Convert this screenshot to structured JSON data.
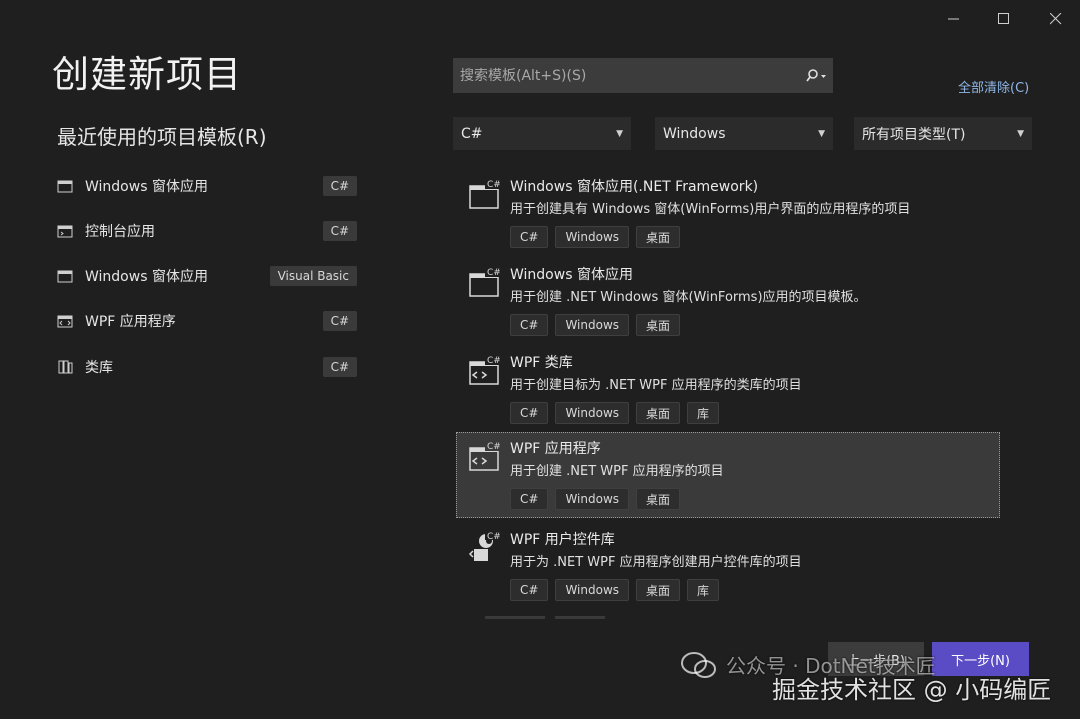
{
  "window": {
    "min_icon": "minimize-icon",
    "max_icon": "maximize-icon",
    "close_icon": "close-icon"
  },
  "page_title": "创建新项目",
  "recent": {
    "title": "最近使用的项目模板(R)",
    "items": [
      {
        "label": "Windows 窗体应用",
        "tag": "C#"
      },
      {
        "label": "控制台应用",
        "tag": "C#"
      },
      {
        "label": "Windows 窗体应用",
        "tag": "Visual Basic"
      },
      {
        "label": "WPF 应用程序",
        "tag": "C#"
      },
      {
        "label": "类库",
        "tag": "C#"
      }
    ]
  },
  "search": {
    "placeholder": "搜索模板(Alt+S)(S)",
    "value": ""
  },
  "clear_all": "全部清除(C)",
  "filters": {
    "language": "C#",
    "platform": "Windows",
    "project_type": "所有项目类型(T)"
  },
  "templates": [
    {
      "name": "Windows 窗体应用(.NET Framework)",
      "desc": "用于创建具有 Windows 窗体(WinForms)用户界面的应用程序的项目",
      "tags": [
        "C#",
        "Windows",
        "桌面"
      ]
    },
    {
      "name": "Windows 窗体应用",
      "desc": "用于创建 .NET Windows 窗体(WinForms)应用的项目模板。",
      "tags": [
        "C#",
        "Windows",
        "桌面"
      ]
    },
    {
      "name": "WPF 类库",
      "desc": "用于创建目标为 .NET WPF 应用程序的类库的项目",
      "tags": [
        "C#",
        "Windows",
        "桌面",
        "库"
      ]
    },
    {
      "name": "WPF 应用程序",
      "desc": "用于创建 .NET WPF 应用程序的项目",
      "tags": [
        "C#",
        "Windows",
        "桌面"
      ]
    },
    {
      "name": "WPF 用户控件库",
      "desc": "用于为 .NET WPF 应用程序创建用户控件库的项目",
      "tags": [
        "C#",
        "Windows",
        "桌面",
        "库"
      ]
    }
  ],
  "buttons": {
    "prev": "上一步(B)",
    "next": "下一步(N)"
  },
  "watermark": {
    "line1": "公众号 · DotNet技术匠",
    "line2": "掘金技术社区 @ 小码编匠"
  },
  "colors": {
    "background": "#1f1f1f",
    "accent": "#5a4cc4",
    "link": "#8fb6e6"
  }
}
